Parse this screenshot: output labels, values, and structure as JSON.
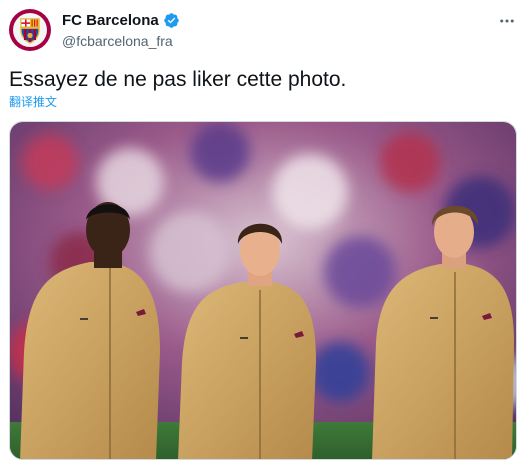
{
  "account": {
    "display_name": "FC Barcelona",
    "handle": "@fcbarcelona_fra",
    "verified": true,
    "avatar_icon": "fc-barcelona-crest-icon"
  },
  "tweet": {
    "text": "Essayez de ne pas liker cette photo.",
    "translate_label": "翻译推文"
  },
  "menu": {
    "icon": "more-horizontal-icon"
  },
  "media": {
    "icon": "photo-three-players"
  },
  "colors": {
    "link": "#1d9bf0",
    "secondary_text": "#536471",
    "primary_text": "#0f1419",
    "jacket": "#c9a15e"
  }
}
